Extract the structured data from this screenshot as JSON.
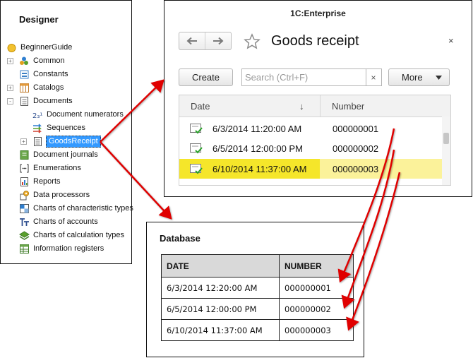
{
  "designer": {
    "title": "Designer",
    "tree": [
      {
        "label": "BeginnerGuide",
        "icon": "configuration-root-icon",
        "expander": ""
      },
      {
        "label": "Common",
        "icon": "common-icon",
        "expander": "+"
      },
      {
        "label": "Constants",
        "icon": "constants-icon",
        "expander": ""
      },
      {
        "label": "Catalogs",
        "icon": "catalogs-icon",
        "expander": "+"
      },
      {
        "label": "Documents",
        "icon": "documents-icon",
        "expander": "-"
      },
      {
        "label": "Document numerators",
        "icon": "document-numerators-icon",
        "expander": ""
      },
      {
        "label": "Sequences",
        "icon": "sequences-icon",
        "expander": ""
      },
      {
        "label": "GoodsReceipt",
        "icon": "document-icon",
        "expander": "+"
      },
      {
        "label": "Document journals",
        "icon": "document-journals-icon",
        "expander": ""
      },
      {
        "label": "Enumerations",
        "icon": "enumerations-icon",
        "expander": ""
      },
      {
        "label": "Reports",
        "icon": "reports-icon",
        "expander": ""
      },
      {
        "label": "Data processors",
        "icon": "data-processors-icon",
        "expander": ""
      },
      {
        "label": "Charts of characteristic types",
        "icon": "charts-characteristic-icon",
        "expander": ""
      },
      {
        "label": "Charts of accounts",
        "icon": "charts-accounts-icon",
        "expander": ""
      },
      {
        "label": "Charts of calculation types",
        "icon": "charts-calculation-icon",
        "expander": ""
      },
      {
        "label": "Information registers",
        "icon": "information-registers-icon",
        "expander": ""
      }
    ]
  },
  "enterprise": {
    "window_title": "1C:Enterprise",
    "form_title": "Goods receipt",
    "close_glyph": "×",
    "back_glyph": "🡐",
    "forward_glyph": "🡒",
    "create_label": "Create",
    "search_placeholder": "Search (Ctrl+F)",
    "search_clear": "×",
    "more_label": "More",
    "columns": {
      "date": "Date",
      "number": "Number",
      "sort_glyph": "↓"
    },
    "rows": [
      {
        "date": "6/3/2014 11:20:00 AM",
        "number": "000000001",
        "selected": false
      },
      {
        "date": "6/5/2014 12:00:00 PM",
        "number": "000000002",
        "selected": false
      },
      {
        "date": "6/10/2014 11:37:00 AM",
        "number": "000000003",
        "selected": true
      }
    ]
  },
  "database": {
    "title": "Database",
    "columns": {
      "date": "DATE",
      "number": "NUMBER"
    },
    "rows": [
      {
        "date": "6/3/2014 12:20:00 AM",
        "number": "000000001"
      },
      {
        "date": "6/5/2014 12:00:00 PM",
        "number": "000000002"
      },
      {
        "date": "6/10/2014 11:37:00 AM",
        "number": "000000003"
      }
    ]
  },
  "colors": {
    "arrow": "#e00000",
    "selected_row": "#f5e62a",
    "selected_row_tail": "#fbf29a",
    "tree_selection": "#3399ff"
  }
}
